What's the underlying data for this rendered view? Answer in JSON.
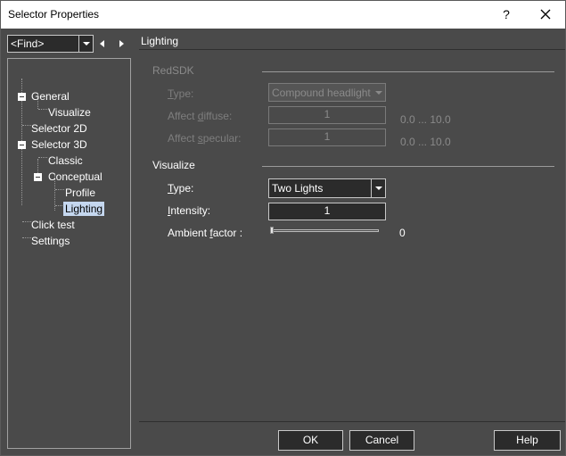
{
  "window": {
    "title": "Selector Properties",
    "help": "?"
  },
  "find": {
    "value": "<Find>"
  },
  "tree": {
    "items": [
      "General",
      "Visualize",
      "Selector 2D",
      "Selector 3D",
      "Classic",
      "Conceptual",
      "Profile",
      "Lighting",
      "Click test",
      "Settings"
    ],
    "selected": "Lighting"
  },
  "panel": {
    "title": "Lighting",
    "redsdk": {
      "group": "RedSDK",
      "type_label": "Type:",
      "type_value": "Compound headlight",
      "diffuse_label": "Affect diffuse:",
      "diffuse_value": "1",
      "diffuse_range": "0.0 ... 10.0",
      "specular_label": "Affect specular:",
      "specular_value": "1",
      "specular_range": "0.0 ... 10.0"
    },
    "visualize": {
      "group": "Visualize",
      "type_label": "Type:",
      "type_value": "Two Lights",
      "intensity_label": "Intensity:",
      "intensity_value": "1",
      "ambient_label": "Ambient factor :",
      "ambient_value": "0",
      "ambient_fraction": 0
    }
  },
  "buttons": {
    "ok": "OK",
    "cancel": "Cancel",
    "help": "Help"
  }
}
